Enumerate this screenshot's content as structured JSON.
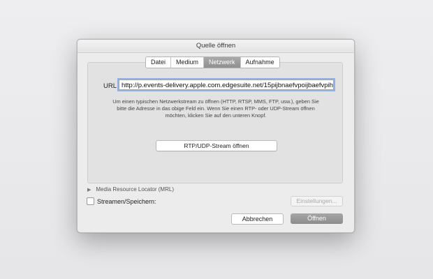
{
  "window": {
    "title": "Quelle öffnen"
  },
  "tabs": [
    {
      "label": "Datei"
    },
    {
      "label": "Medium"
    },
    {
      "label": "Netzwerk",
      "active": true
    },
    {
      "label": "Aufnahme"
    }
  ],
  "network": {
    "url_label": "URL",
    "url_value": "http://p.events-delivery.apple.com.edgesuite.net/15pijbnaefvpoijbaefvpihb",
    "help_text_1": "Um einen typischen Netzwerkstream zu öffnen (HTTP, RTSP, MMS, FTP, usw.), geben Sie",
    "help_text_2": "bitte die Adresse in das obige Feld ein. Wenn Sie einen RTP- oder UDP-Stream öffnen",
    "help_text_3": "möchten, klicken Sie auf den unteren Knopf.",
    "rtp_button": "RTP/UDP-Stream öffnen"
  },
  "mrl": {
    "label": "Media Resource Locator (MRL)",
    "icon": "disclosure-triangle-icon"
  },
  "stream": {
    "label": "Streamen/Speichern:",
    "checked": false,
    "settings_button": "Einstellungen..."
  },
  "footer": {
    "cancel_button": "Abbrechen",
    "open_button": "Öffnen"
  },
  "colors": {
    "focus_ring": "#8fb1e5",
    "active_tab": "#9a9a9a"
  }
}
